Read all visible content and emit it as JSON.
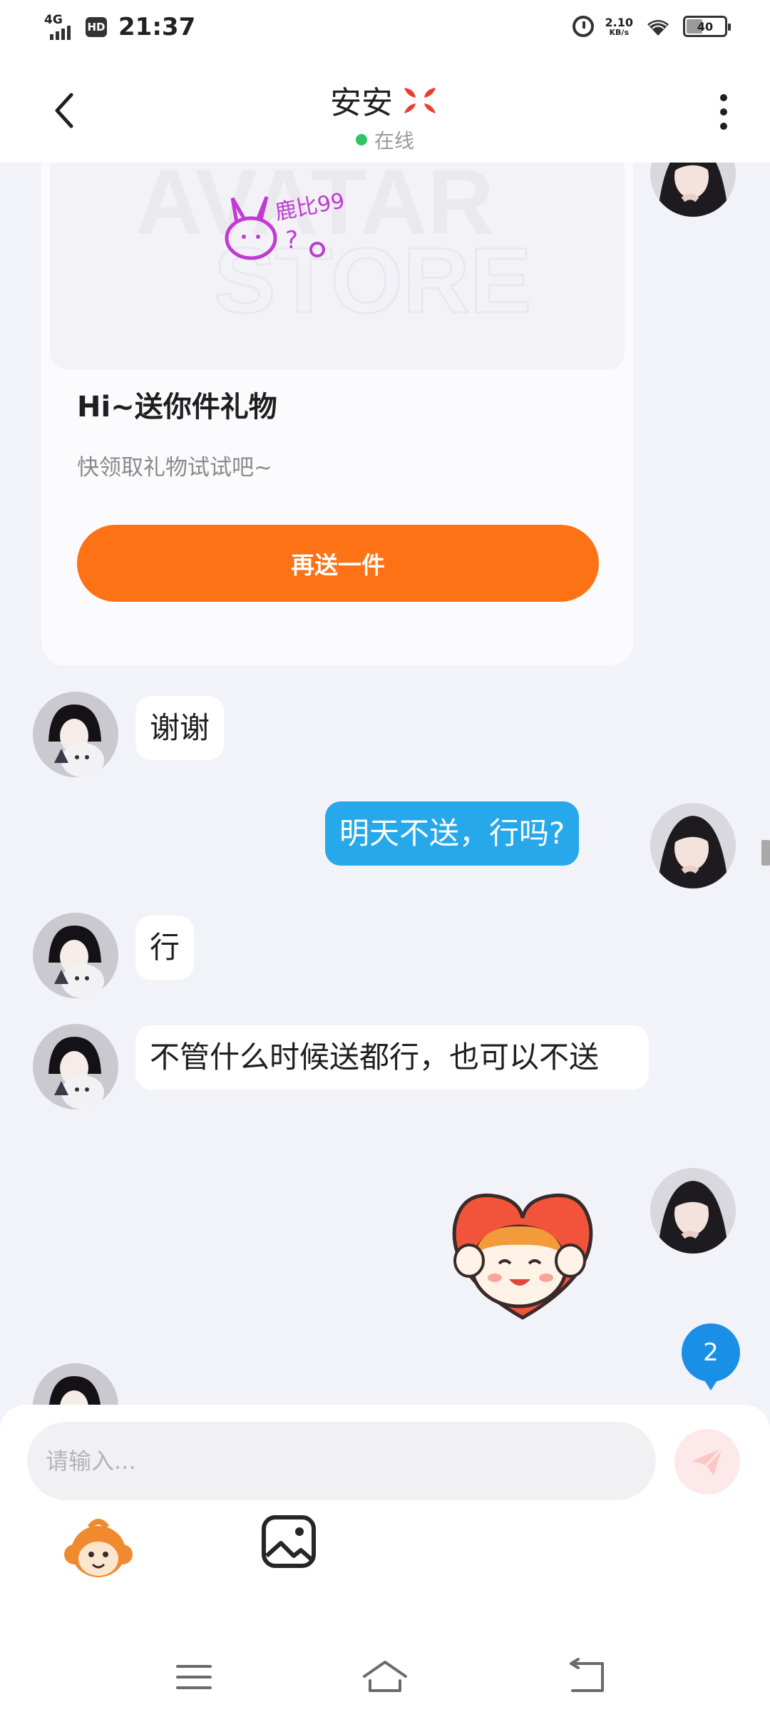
{
  "status_bar": {
    "network": "4G",
    "hd": "HD",
    "time": "21:37",
    "speed_value": "2.10",
    "speed_unit": "KB/s",
    "battery": "40",
    "icons": [
      "signal-icon",
      "alarm-icon",
      "wifi-icon",
      "battery-icon"
    ]
  },
  "header": {
    "title": "安安",
    "title_icon": "anger-icon",
    "status": "在线",
    "status_color": "#2fc462",
    "back_icon": "back-chevron-icon",
    "more_icon": "more-vertical-icon"
  },
  "gift_card": {
    "image_text": [
      "AVATAR",
      "STORE",
      "鹿比99"
    ],
    "title": "Hi~送你件礼物",
    "subtitle": "快领取礼物试试吧~",
    "button_label": "再送一件",
    "button_color": "#fd7214"
  },
  "messages": [
    {
      "from": "other",
      "type": "text",
      "text": "谢谢"
    },
    {
      "from": "me",
      "type": "text",
      "text": "明天不送，行吗?"
    },
    {
      "from": "other",
      "type": "text",
      "text": "行"
    },
    {
      "from": "other",
      "type": "text",
      "text": "不管什么时候送都行，也可以不送"
    },
    {
      "from": "me",
      "type": "sticker",
      "icon": "heart-hug-sticker-icon"
    }
  ],
  "unread_badge": "2",
  "input": {
    "placeholder": "请输入...",
    "send_icon": "send-paper-plane-icon",
    "emoji_icon": "emoji-monkey-icon",
    "image_icon": "image-gallery-icon"
  },
  "colors": {
    "my_bubble": "#27a8ea",
    "accent_orange": "#fd7214",
    "chat_background": "#f2f3f8"
  },
  "nav": {
    "icons": [
      "menu-icon",
      "home-icon",
      "back-icon"
    ]
  }
}
